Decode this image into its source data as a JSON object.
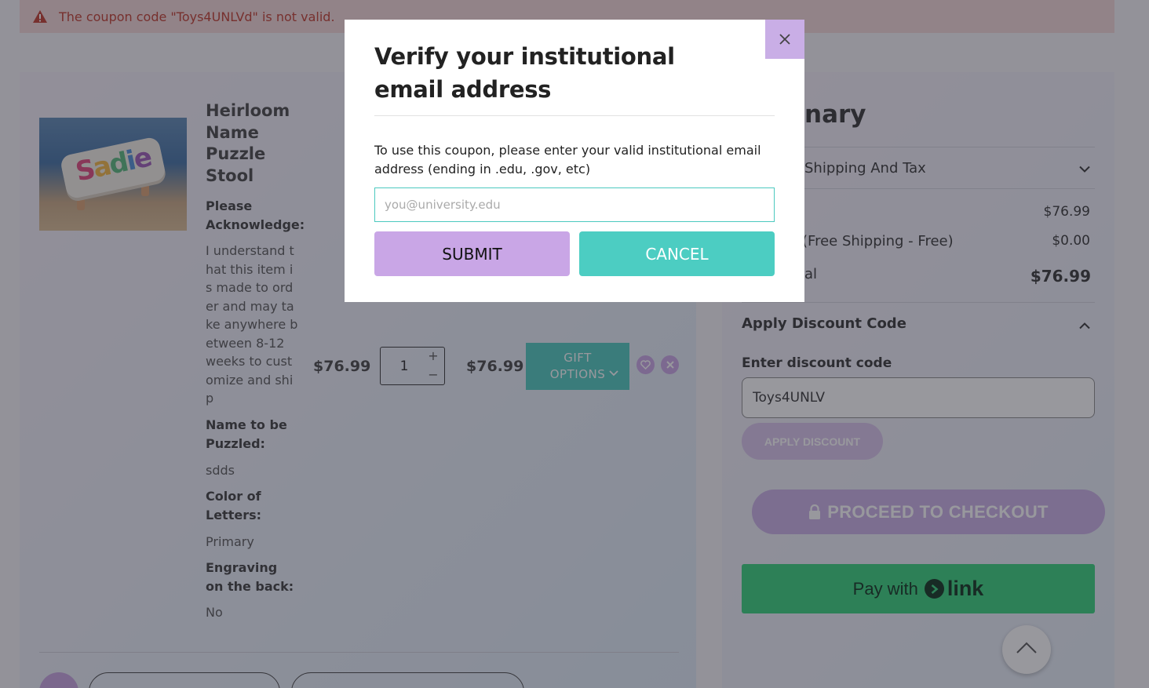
{
  "alert": {
    "message": "The coupon code \"Toys4UNLVd\" is not valid.",
    "color": "#c0392b"
  },
  "product": {
    "title": "Heirloom Name Puzzle Stool",
    "image_text": "Sadie",
    "options": [
      {
        "label": "Please Acknowledge:",
        "value": "I understand that this item is made to order and may take anywhere between 8-12 weeks to customize and ship"
      },
      {
        "label": "Name to be Puzzled:",
        "value": "sdds"
      },
      {
        "label": "Color of Letters:",
        "value": "Primary"
      },
      {
        "label": "Engraving on the back:",
        "value": "No"
      }
    ],
    "unit_price": "$76.99",
    "quantity": "1",
    "line_total": "$76.99",
    "gift_options_label": "GIFT OPTIONS"
  },
  "summary": {
    "title_fragment": "nary",
    "shipping_tax_label": "Shipping And Tax",
    "subtotal_value": "$76.99",
    "shipping_label": "(Free Shipping - Free)",
    "shipping_value": "$0.00",
    "total_label_fragment": "al",
    "total_value": "$76.99",
    "apply_discount_heading": "Apply Discount Code",
    "discount_field_label": "Enter discount code",
    "discount_value": "Toys4UNLV",
    "apply_button": "APPLY DISCOUNT",
    "checkout_button": "PROCEED TO CHECKOUT",
    "pay_with_label": "Pay with",
    "link_word": "link"
  },
  "modal": {
    "title": "Verify your institutional email address",
    "description": "To use this coupon, please enter your valid institutional email address (ending in .edu, .gov, etc)",
    "email_placeholder": "you@university.edu",
    "email_value": "",
    "submit_label": "SUBMIT",
    "cancel_label": "CANCEL"
  },
  "colors": {
    "accent_purple": "#c9aee6",
    "accent_teal": "#4cc9bf",
    "link_green": "#33d17a",
    "error_red": "#c0392b"
  },
  "icons": [
    "warning-icon",
    "close-icon",
    "heart-icon",
    "remove-icon",
    "chevron-down-icon",
    "chevron-up-icon",
    "lock-icon",
    "link-arrow-icon",
    "scroll-top-icon"
  ]
}
